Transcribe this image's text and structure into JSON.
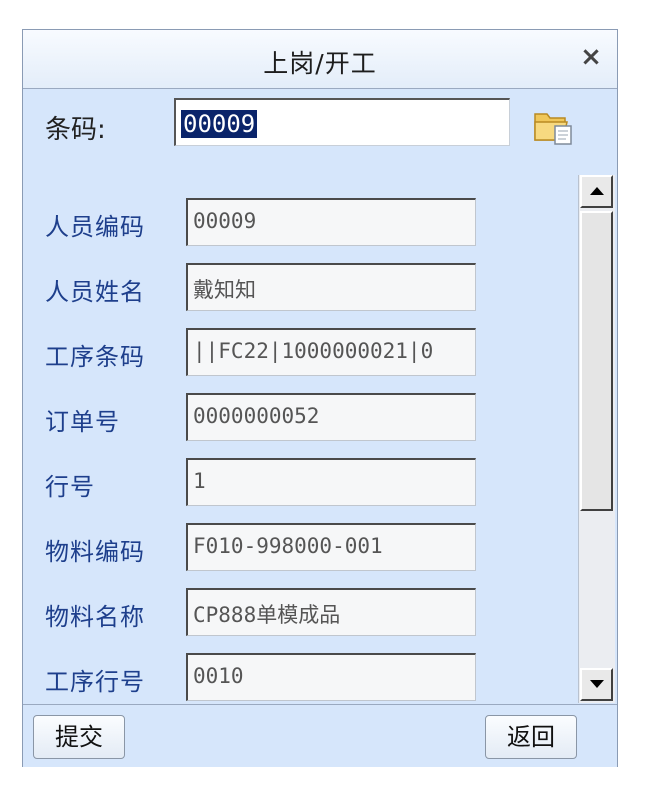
{
  "window": {
    "title": "上岗/开工",
    "close_symbol": "×"
  },
  "barcode": {
    "label": "条码:",
    "value": "00009"
  },
  "fields": [
    {
      "label": "人员编码",
      "value": "00009"
    },
    {
      "label": "人员姓名",
      "value": "戴知知"
    },
    {
      "label": "工序条码",
      "value": "||FC22|1000000021|0"
    },
    {
      "label": "订单号",
      "value": "0000000052"
    },
    {
      "label": "行号",
      "value": "1"
    },
    {
      "label": "物料编码",
      "value": "F010-998000-001"
    },
    {
      "label": "物料名称",
      "value": "CP888单模成品"
    },
    {
      "label": "工序行号",
      "value": "0010"
    }
  ],
  "buttons": {
    "submit_label": "提交",
    "back_label": "返回"
  },
  "icons": {
    "folder": "folder-open-icon",
    "scroll_up": "scroll-up-arrow-icon",
    "scroll_down": "scroll-down-arrow-icon"
  },
  "colors": {
    "window_bg": "#d6e6fb",
    "label_text": "#1e3f8c",
    "selection": "#0a246a"
  }
}
